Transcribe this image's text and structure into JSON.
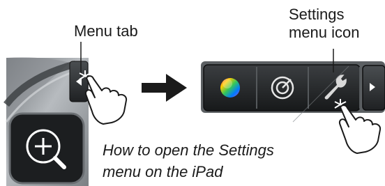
{
  "labels": {
    "menu_tab": "Menu tab",
    "settings_icon_line1": "Settings",
    "settings_icon_line2": "menu icon"
  },
  "caption": {
    "line1": "How to open the Settings",
    "line2": "menu on the iPad"
  },
  "icons": {
    "zoom": "zoom-in-icon",
    "color": "color-wheel-icon",
    "radar": "radar-icon",
    "settings": "wrench-icon",
    "more": "arrow-right-icon",
    "tab": "arrow-left-icon",
    "hand": "pointing-hand-icon",
    "flow": "arrow-right-icon"
  },
  "colors": {
    "panel": "#2e3032",
    "button_border": "#55595c",
    "metal": "#9a9ea2",
    "arrow": "#1a1a1a"
  }
}
